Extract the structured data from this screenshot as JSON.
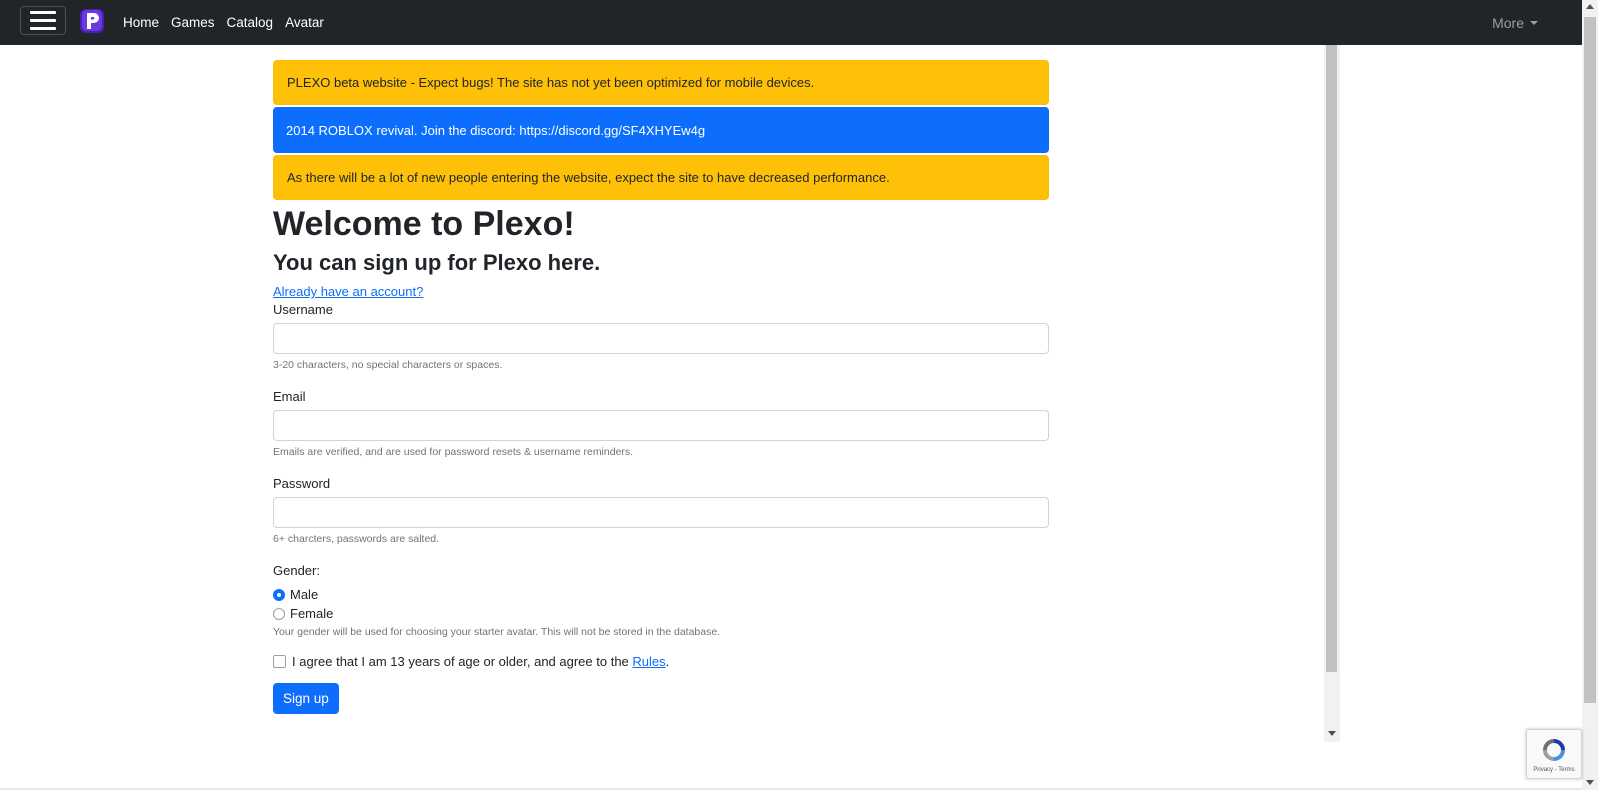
{
  "navbar": {
    "links": [
      "Home",
      "Games",
      "Catalog",
      "Avatar"
    ],
    "more_label": "More"
  },
  "alerts": [
    {
      "text": "PLEXO beta website - Expect bugs! The site has not yet been optimized for mobile devices.",
      "type": "warning"
    },
    {
      "text": "2014 ROBLOX revival. Join the discord: https://discord.gg/SF4XHYEw4g",
      "type": "primary"
    },
    {
      "text": "As there will be a lot of new people entering the website, expect the site to have decreased performance.",
      "type": "warning"
    }
  ],
  "main": {
    "title": "Welcome to Plexo!",
    "subtitle": "You can sign up for Plexo here.",
    "login_link": "Already have an account?"
  },
  "form": {
    "username": {
      "label": "Username",
      "value": "",
      "hint": "3-20 characters, no special characters or spaces."
    },
    "email": {
      "label": "Email",
      "value": "",
      "hint": "Emails are verified, and are used for password resets & username reminders."
    },
    "password": {
      "label": "Password",
      "value": "",
      "hint": "6+ charcters, passwords are salted."
    },
    "gender": {
      "label": "Gender:",
      "options": [
        "Male",
        "Female"
      ],
      "selected": "Male",
      "hint": "Your gender will be used for choosing your starter avatar. This will not be stored in the database."
    },
    "agree": {
      "text": "I agree that I am 13 years of age or older, and agree to the",
      "link": "Rules",
      "suffix": ".",
      "checked": false
    },
    "submit_label": "Sign up"
  },
  "recaptcha": {
    "text": "Privacy - Terms"
  },
  "colors": {
    "navbar": "#212529",
    "warning": "#ffc107",
    "primary": "#0d6efd",
    "logo": "#5b2bd9"
  }
}
